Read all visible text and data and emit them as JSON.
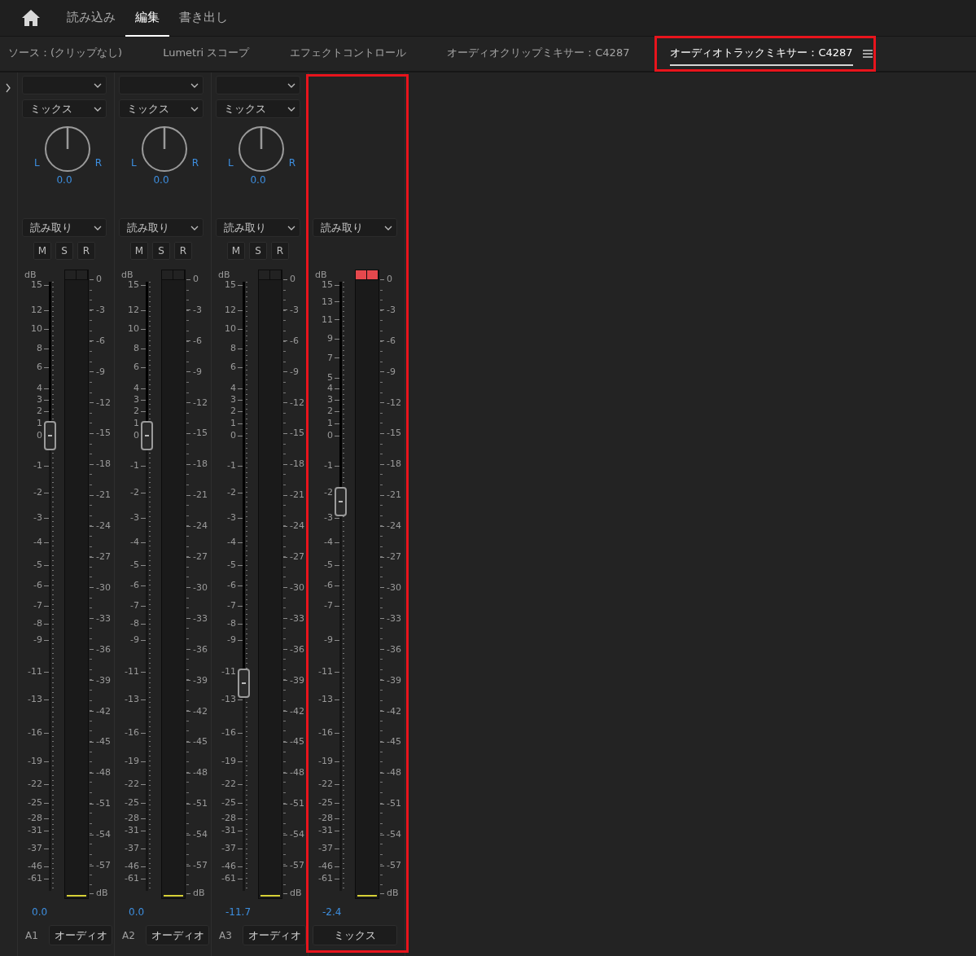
{
  "top_tabs": [
    {
      "label": "読み込み",
      "selected": false
    },
    {
      "label": "編集",
      "selected": true
    },
    {
      "label": "書き出し",
      "selected": false
    }
  ],
  "panel_tabs": [
    {
      "label": "ソース：(クリップなし)",
      "selected": false,
      "highlighted": false
    },
    {
      "label": "Lumetri スコープ",
      "selected": false,
      "highlighted": false
    },
    {
      "label": "エフェクトコントロール",
      "selected": false,
      "highlighted": false
    },
    {
      "label": "オーディオクリップミキサー：C4287",
      "selected": false,
      "highlighted": false
    },
    {
      "label": "オーディオトラックミキサー：C4287",
      "selected": true,
      "highlighted": true
    }
  ],
  "channels": [
    {
      "kind": "track",
      "output": "ミックス",
      "pan": {
        "left": "L",
        "right": "R",
        "value": "0.0"
      },
      "automation": "読み取り",
      "buttons": [
        "M",
        "S",
        "R"
      ],
      "fader": {
        "unit": "dB",
        "scale": [
          "15",
          "12",
          "10",
          "8",
          "6",
          "4",
          "3",
          "2",
          "1",
          "0",
          "-1",
          "-2",
          "-3",
          "-4",
          "-5",
          "-6",
          "-7",
          "-8",
          "-9",
          "-11",
          "-13",
          "-16",
          "-19",
          "-22",
          "-25",
          "-28",
          "-31",
          "-37",
          "-46",
          "-61"
        ],
        "level": 0.747
      },
      "meter": {
        "scale": [
          "0",
          "-3",
          "-6",
          "-9",
          "-12",
          "-15",
          "-18",
          "-21",
          "-24",
          "-27",
          "-30",
          "-33",
          "-36",
          "-39",
          "-42",
          "-45",
          "-48",
          "-51",
          "-54",
          "-57"
        ],
        "unit": "dB",
        "clipped": false
      },
      "volume": "0.0",
      "track_label": "A1",
      "name": "オーディオ",
      "highlighted": false
    },
    {
      "kind": "track",
      "output": "ミックス",
      "pan": {
        "left": "L",
        "right": "R",
        "value": "0.0"
      },
      "automation": "読み取り",
      "buttons": [
        "M",
        "S",
        "R"
      ],
      "fader": {
        "unit": "dB",
        "scale": [
          "15",
          "12",
          "10",
          "8",
          "6",
          "4",
          "3",
          "2",
          "1",
          "0",
          "-1",
          "-2",
          "-3",
          "-4",
          "-5",
          "-6",
          "-7",
          "-8",
          "-9",
          "-11",
          "-13",
          "-16",
          "-19",
          "-22",
          "-25",
          "-28",
          "-31",
          "-37",
          "-46",
          "-61"
        ],
        "level": 0.747
      },
      "meter": {
        "scale": [
          "0",
          "-3",
          "-6",
          "-9",
          "-12",
          "-15",
          "-18",
          "-21",
          "-24",
          "-27",
          "-30",
          "-33",
          "-36",
          "-39",
          "-42",
          "-45",
          "-48",
          "-51",
          "-54",
          "-57"
        ],
        "unit": "dB",
        "clipped": false
      },
      "volume": "0.0",
      "track_label": "A2",
      "name": "オーディオ",
      "highlighted": false
    },
    {
      "kind": "track",
      "output": "ミックス",
      "pan": {
        "left": "L",
        "right": "R",
        "value": "0.0"
      },
      "automation": "読み取り",
      "buttons": [
        "M",
        "S",
        "R"
      ],
      "fader": {
        "unit": "dB",
        "scale": [
          "15",
          "12",
          "10",
          "8",
          "6",
          "4",
          "3",
          "2",
          "1",
          "0",
          "-1",
          "-2",
          "-3",
          "-4",
          "-5",
          "-6",
          "-7",
          "-8",
          "-9",
          "-11",
          "-13",
          "-16",
          "-19",
          "-22",
          "-25",
          "-28",
          "-31",
          "-37",
          "-46",
          "-61"
        ],
        "level": 0.341
      },
      "meter": {
        "scale": [
          "0",
          "-3",
          "-6",
          "-9",
          "-12",
          "-15",
          "-18",
          "-21",
          "-24",
          "-27",
          "-30",
          "-33",
          "-36",
          "-39",
          "-42",
          "-45",
          "-48",
          "-51",
          "-54",
          "-57"
        ],
        "unit": "dB",
        "clipped": false
      },
      "volume": "-11.7",
      "track_label": "A3",
      "name": "オーディオ",
      "highlighted": false
    },
    {
      "kind": "mix",
      "automation": "読み取り",
      "fader": {
        "unit": "dB",
        "scale": [
          "15",
          "13",
          "11",
          "9",
          "7",
          "5",
          "4",
          "3",
          "2",
          "1",
          "0",
          "-1",
          "-2",
          "-3",
          "-4",
          "-5",
          "-6",
          "-7",
          "-9",
          "-11",
          "-13",
          "-16",
          "-19",
          "-22",
          "-25",
          "-28",
          "-31",
          "-37",
          "-46",
          "-61"
        ],
        "level": 0.639
      },
      "meter": {
        "scale": [
          "0",
          "-3",
          "-6",
          "-9",
          "-12",
          "-15",
          "-18",
          "-21",
          "-24",
          "-27",
          "-30",
          "-33",
          "-36",
          "-39",
          "-42",
          "-45",
          "-48",
          "-51",
          "-54",
          "-57"
        ],
        "unit": "dB",
        "clipped": true
      },
      "volume": "-2.4",
      "name": "ミックス",
      "highlighted": true
    }
  ]
}
